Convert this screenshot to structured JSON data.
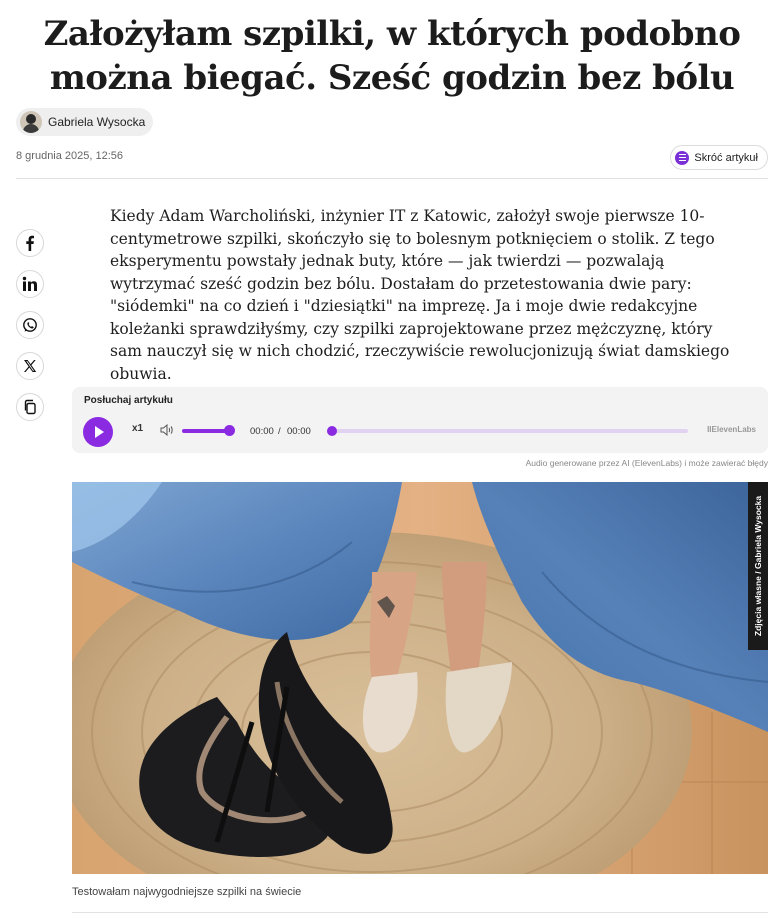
{
  "article": {
    "title": "Założyłam szpilki, w których podobno można biegać. Sześć godzin bez bólu",
    "author": "Gabriela Wysocka",
    "date": "8 grudnia 2025, 12:56",
    "summarize_label": "Skróć artykuł",
    "lead": "Kiedy Adam Warcholiński, inżynier IT z Katowic, założył swoje pierwsze 10-centymetrowe szpilki, skończyło się to bolesnym potknięciem o stolik. Z tego eksperymentu powstały jednak buty, które — jak twierdzi — pozwalają wytrzymać sześć godzin bez bólu. Dostałam do przetestowania dwie pary: \"siódemki\" na co dzień i \"dziesiątki\" na imprezę. Ja i moje dwie redakcyjne koleżanki sprawdziłyśmy, czy szpilki zaprojektowane przez mężczyznę, który sam nauczył się w nich chodzić, rzeczywiście rewolucjonizują świat damskiego obuwia."
  },
  "share": {
    "icons": [
      "facebook-icon",
      "linkedin-icon",
      "whatsapp-icon",
      "x-icon",
      "copy-icon"
    ]
  },
  "player": {
    "title": "Posłuchaj artykułu",
    "speed": "x1",
    "current_time": "00:00",
    "separator": "/",
    "total_time": "00:00",
    "provider": "IIElevenLabs",
    "volume_level": 1.0,
    "progress": 0.0,
    "accent_color": "#8a2be2"
  },
  "ai_note": "Audio generowane przez AI (ElevenLabs) i może zawierać błędy",
  "photo": {
    "credit": "Zdjęcia własne / Gabriela Wysocka",
    "caption": "Testowałam najwygodniejsze szpilki na świecie"
  }
}
